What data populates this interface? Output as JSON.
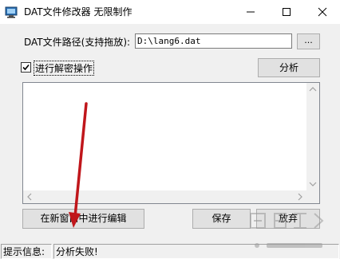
{
  "window": {
    "title": "DAT文件修改器  无限制作",
    "minimize_glyph": "—",
    "maximize_glyph": "☐",
    "close_glyph": "✕"
  },
  "path": {
    "label": "DAT文件路径(支持拖放):",
    "value": "D:\\lang6.dat",
    "browse_label": "..."
  },
  "decrypt": {
    "label": "进行解密操作",
    "checked": true
  },
  "analyze_button": "分析",
  "buttons": {
    "edit_new_window": "在新窗口中进行编辑",
    "save": "保存",
    "discard": "放弃"
  },
  "status": {
    "label": "提示信息:",
    "message": "分析失败!"
  },
  "icons": {
    "app": "computer-app-icon",
    "checkbox_check": "check-icon"
  },
  "colors": {
    "accent_arrow": "#c0161b"
  }
}
